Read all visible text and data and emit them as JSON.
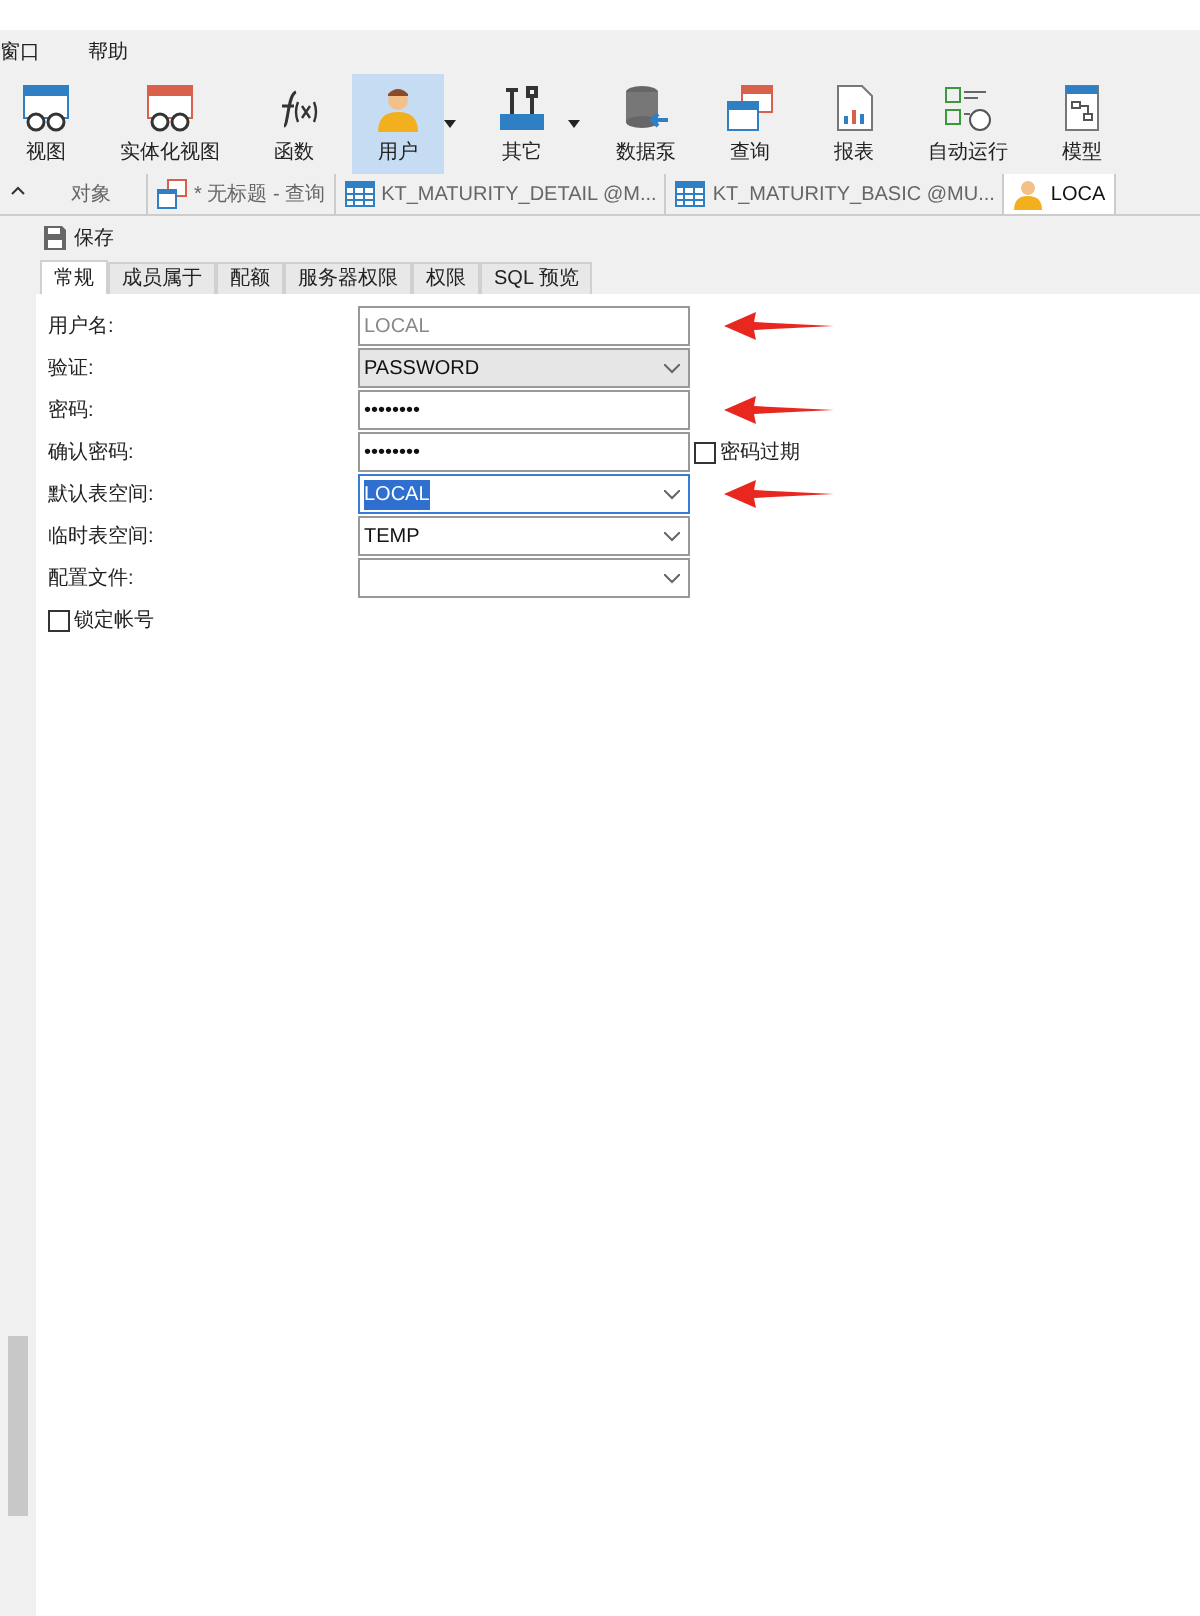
{
  "menu": [
    "窗口",
    "帮助"
  ],
  "toolbar": [
    {
      "label": "视图",
      "kind": "view",
      "selected": false,
      "dropdown": false
    },
    {
      "label": "实体化视图",
      "kind": "mview",
      "selected": false,
      "dropdown": false
    },
    {
      "label": "函数",
      "kind": "func",
      "selected": false,
      "dropdown": false
    },
    {
      "label": "用户",
      "kind": "user",
      "selected": true,
      "dropdown": true
    },
    {
      "label": "其它",
      "kind": "tools",
      "selected": false,
      "dropdown": true
    },
    {
      "label": "数据泵",
      "kind": "db",
      "selected": false,
      "dropdown": false
    },
    {
      "label": "查询",
      "kind": "query",
      "selected": false,
      "dropdown": false
    },
    {
      "label": "报表",
      "kind": "report",
      "selected": false,
      "dropdown": false
    },
    {
      "label": "自动运行",
      "kind": "auto",
      "selected": false,
      "dropdown": false
    },
    {
      "label": "模型",
      "kind": "model",
      "selected": false,
      "dropdown": false
    }
  ],
  "doc_tabs": [
    {
      "label": "对象",
      "kind": "none",
      "selected": false
    },
    {
      "label": "* 无标题 - 查询",
      "kind": "query",
      "selected": false
    },
    {
      "label": "KT_MATURITY_DETAIL @M...",
      "kind": "table",
      "selected": false
    },
    {
      "label": "KT_MATURITY_BASIC @MU...",
      "kind": "table",
      "selected": false
    },
    {
      "label": "LOCA",
      "kind": "user",
      "selected": true
    }
  ],
  "save_button": "保存",
  "form_tabs": [
    {
      "label": "常规",
      "selected": true
    },
    {
      "label": "成员属于",
      "selected": false
    },
    {
      "label": "配额",
      "selected": false
    },
    {
      "label": "服务器权限",
      "selected": false
    },
    {
      "label": "权限",
      "selected": false
    },
    {
      "label": "SQL 预览",
      "selected": false
    }
  ],
  "fields": [
    {
      "label": "用户名:",
      "kind": "text",
      "value": "LOCAL",
      "disabled": true,
      "focused": false,
      "annotated": true
    },
    {
      "label": "验证:",
      "kind": "select",
      "value": "PASSWORD",
      "disabled": true,
      "focused": false,
      "annotated": false
    },
    {
      "label": "密码:",
      "kind": "text",
      "value": "••••••••",
      "disabled": false,
      "focused": false,
      "annotated": true
    },
    {
      "label": "确认密码:",
      "kind": "text",
      "value": "••••••••",
      "disabled": false,
      "focused": false,
      "annotated": false,
      "checkbox": {
        "label": "密码过期",
        "checked": false
      }
    },
    {
      "label": "默认表空间:",
      "kind": "select",
      "value": "LOCAL",
      "disabled": false,
      "focused": true,
      "annotated": true
    },
    {
      "label": "临时表空间:",
      "kind": "select",
      "value": "TEMP",
      "disabled": false,
      "focused": false,
      "annotated": false
    },
    {
      "label": "配置文件:",
      "kind": "select",
      "disabled": false,
      "focused": false,
      "annotated": false
    }
  ],
  "lock_account": {
    "label": "锁定帐号",
    "checked": false
  }
}
